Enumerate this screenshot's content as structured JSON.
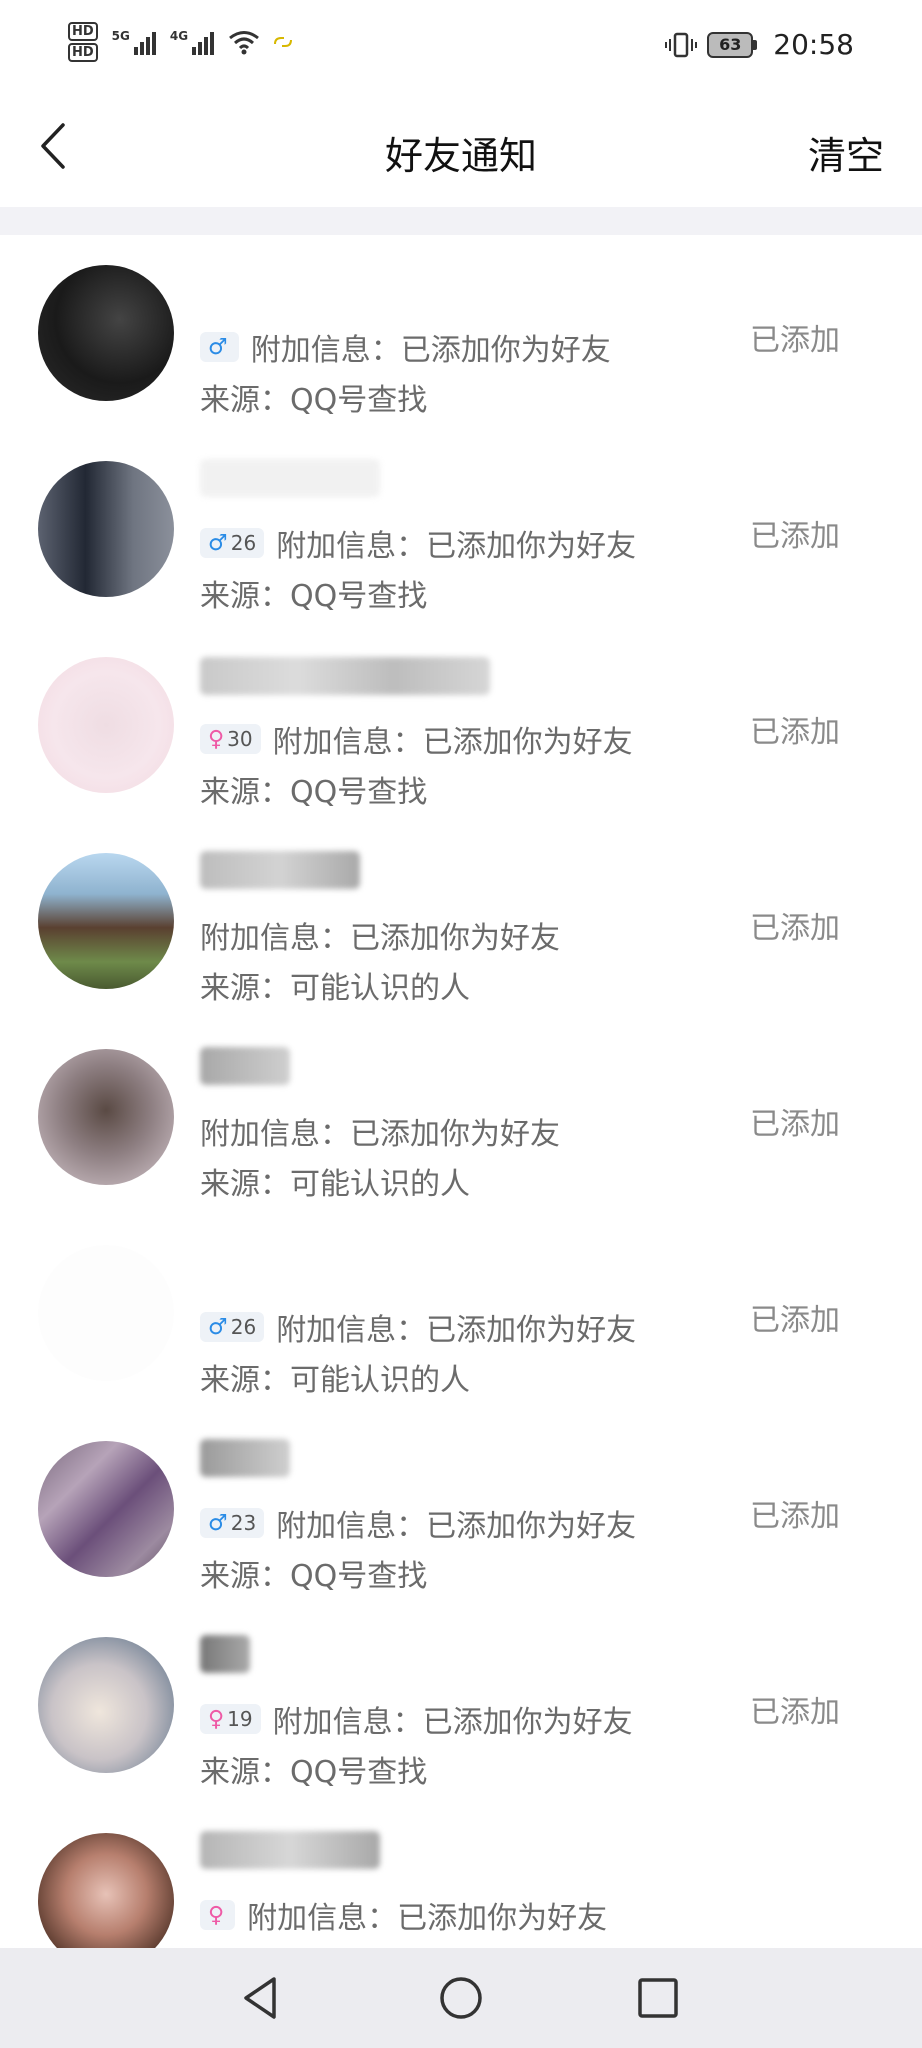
{
  "status_bar": {
    "hd1": "HD",
    "hd2": "HD",
    "net1": "5G",
    "net2": "4G",
    "battery": "63",
    "time": "20:58",
    "icons": [
      "hd-icon",
      "signal-icon",
      "wifi-icon",
      "link-icon",
      "vibrate-icon",
      "battery-icon"
    ]
  },
  "header": {
    "back_icon": "chevron-left-icon",
    "title": "好友通知",
    "clear_label": "清空"
  },
  "colors": {
    "male": "#2b8ce6",
    "female": "#ee5aa6",
    "muted_text": "#6b6b6b",
    "status_text": "#8a8a8a",
    "divider": "#f2f2f6",
    "navbar": "#ececf0"
  },
  "notifications": [
    {
      "gender": "male",
      "age": "",
      "message": "附加信息：已添加你为好友",
      "source": "来源：QQ号查找",
      "status": "已添加"
    },
    {
      "gender": "male",
      "age": "26",
      "message": "附加信息：已添加你为好友",
      "source": "来源：QQ号查找",
      "status": "已添加"
    },
    {
      "gender": "female",
      "age": "30",
      "message": "附加信息：已添加你为好友",
      "source": "来源：QQ号查找",
      "status": "已添加"
    },
    {
      "gender": "",
      "age": "",
      "message": "附加信息：已添加你为好友",
      "source": "来源：可能认识的人",
      "status": "已添加"
    },
    {
      "gender": "",
      "age": "",
      "message": "附加信息：已添加你为好友",
      "source": "来源：可能认识的人",
      "status": "已添加"
    },
    {
      "gender": "male",
      "age": "26",
      "message": "附加信息：已添加你为好友",
      "source": "来源：可能认识的人",
      "status": "已添加"
    },
    {
      "gender": "male",
      "age": "23",
      "message": "附加信息：已添加你为好友",
      "source": "来源：QQ号查找",
      "status": "已添加"
    },
    {
      "gender": "female",
      "age": "19",
      "message": "附加信息：已添加你为好友",
      "source": "来源：QQ号查找",
      "status": "已添加"
    },
    {
      "gender": "female",
      "age": "",
      "message": "附加信息：已添加你为好友",
      "source": "",
      "status": ""
    }
  ],
  "navbar": {
    "icons": [
      "back-triangle-icon",
      "home-circle-icon",
      "recents-square-icon"
    ]
  }
}
